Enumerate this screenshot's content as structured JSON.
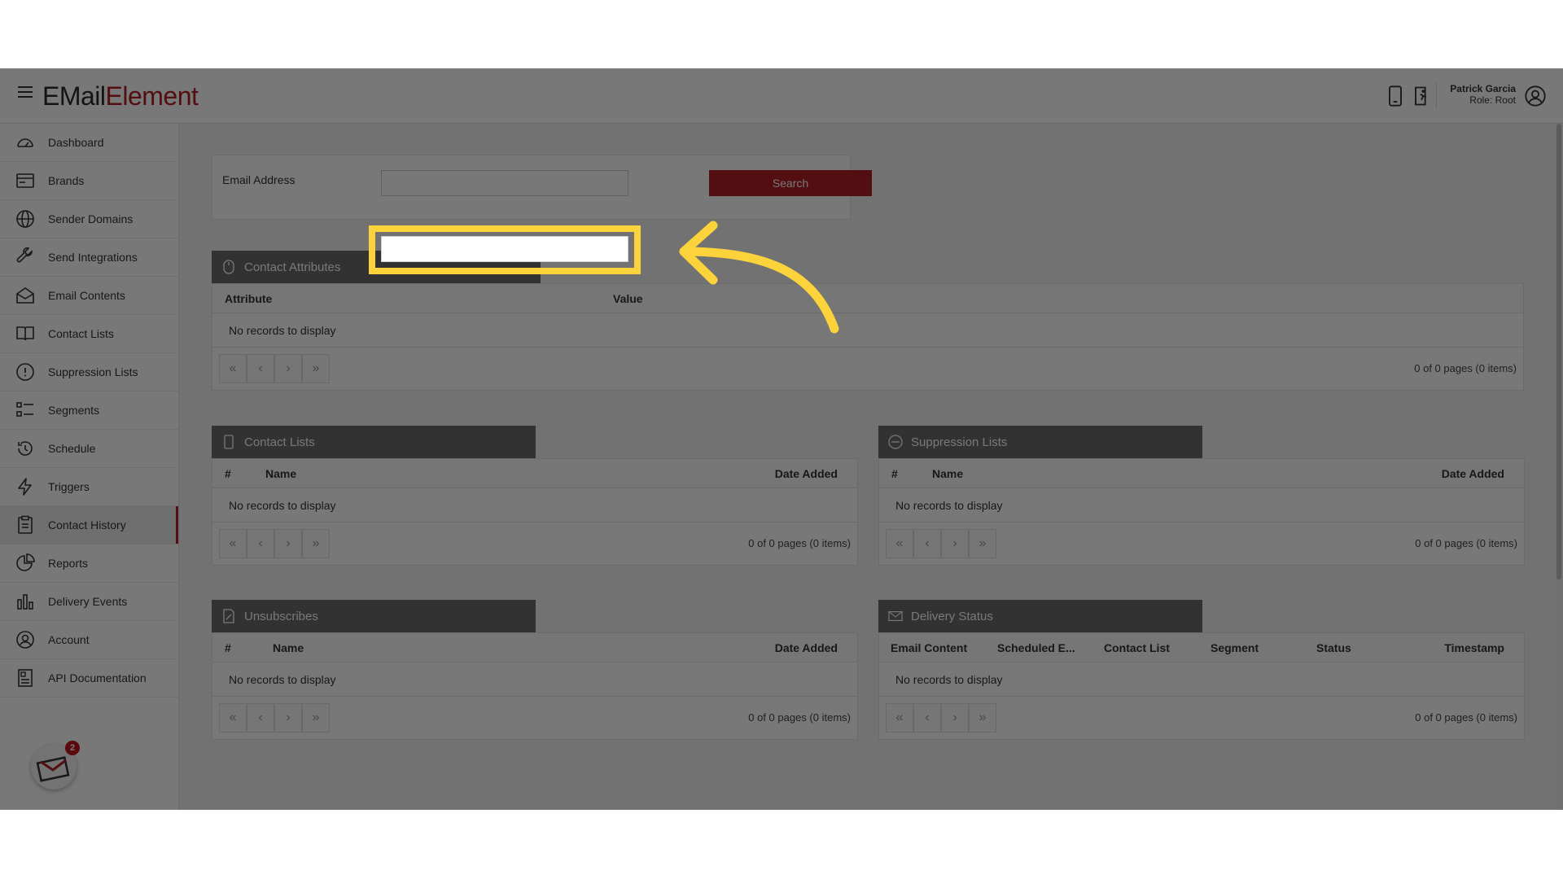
{
  "app": {
    "logo_part1": "EMail",
    "logo_part2": "Element",
    "user_name": "Patrick Garcia",
    "user_role": "Role: Root",
    "accent_color": "#b01e24"
  },
  "sidebar": {
    "items": [
      {
        "label": "Dashboard",
        "icon": "speedometer-icon"
      },
      {
        "label": "Brands",
        "icon": "id-card-icon"
      },
      {
        "label": "Sender Domains",
        "icon": "globe-icon"
      },
      {
        "label": "Send Integrations",
        "icon": "wrench-icon"
      },
      {
        "label": "Email Contents",
        "icon": "envelope-open-icon"
      },
      {
        "label": "Contact Lists",
        "icon": "book-icon"
      },
      {
        "label": "Suppression Lists",
        "icon": "alert-circle-icon"
      },
      {
        "label": "Segments",
        "icon": "list-icon"
      },
      {
        "label": "Schedule",
        "icon": "clock-icon"
      },
      {
        "label": "Triggers",
        "icon": "lightning-icon"
      },
      {
        "label": "Contact History",
        "icon": "clipboard-icon"
      },
      {
        "label": "Reports",
        "icon": "pie-chart-icon"
      },
      {
        "label": "Delivery Events",
        "icon": "bar-chart-icon"
      },
      {
        "label": "Account",
        "icon": "user-circle-icon"
      },
      {
        "label": "API Documentation",
        "icon": "document-icon"
      }
    ],
    "active": "Contact History",
    "notification_count": "2"
  },
  "search": {
    "label": "Email Address",
    "value": "",
    "button_label": "Search"
  },
  "panels": {
    "contact_attributes": {
      "title": "Contact Attributes",
      "columns": [
        "Attribute",
        "Value"
      ],
      "empty": "No records to display",
      "pager_info": "0 of 0 pages (0 items)"
    },
    "contact_lists": {
      "title": "Contact Lists",
      "columns": [
        "#",
        "Name",
        "Date Added"
      ],
      "empty": "No records to display",
      "pager_info": "0 of 0 pages (0 items)"
    },
    "suppression_lists": {
      "title": "Suppression Lists",
      "columns": [
        "#",
        "Name",
        "Date Added"
      ],
      "empty": "No records to display",
      "pager_info": "0 of 0 pages (0 items)"
    },
    "unsubscribes": {
      "title": "Unsubscribes",
      "columns": [
        "#",
        "Name",
        "Date Added"
      ],
      "empty": "No records to display",
      "pager_info": "0 of 0 pages (0 items)"
    },
    "delivery_status": {
      "title": "Delivery Status",
      "columns": [
        "Email Content",
        "Scheduled E...",
        "Contact List",
        "Segment",
        "Status",
        "Timestamp"
      ],
      "empty": "No records to display",
      "pager_info": "0 of 0 pages (0 items)"
    }
  },
  "pager_buttons": [
    "«",
    "‹",
    "›",
    "»"
  ],
  "annotation": {
    "highlight_color": "#fcd33a"
  }
}
